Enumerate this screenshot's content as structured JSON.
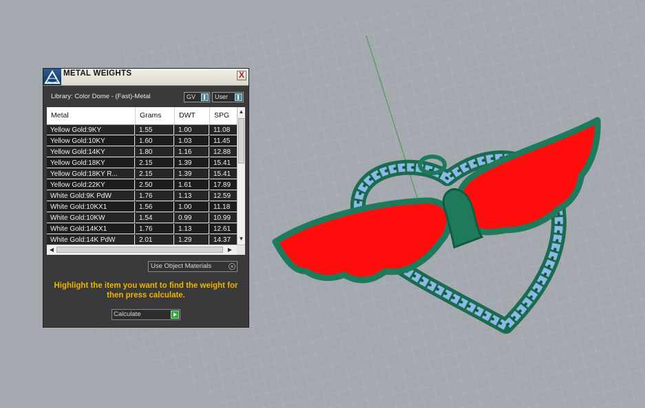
{
  "panel": {
    "title": "METAL WEIGHTS",
    "close_label": "X",
    "library_label": "Library: Color Dome - (Fast)-Metal",
    "unit_select": "GV",
    "mode_select": "User",
    "columns": [
      "Metal",
      "Grams",
      "DWT",
      "SPG"
    ],
    "rows": [
      {
        "metal": "Yellow Gold:9KY",
        "grams": "1.55",
        "dwt": "1.00",
        "spg": "11.08"
      },
      {
        "metal": "Yellow Gold:10KY",
        "grams": "1.60",
        "dwt": "1.03",
        "spg": "11.45"
      },
      {
        "metal": "Yellow Gold:14KY",
        "grams": "1.80",
        "dwt": "1.16",
        "spg": "12.88"
      },
      {
        "metal": "Yellow Gold:18KY",
        "grams": "2.15",
        "dwt": "1.39",
        "spg": "15.41"
      },
      {
        "metal": "Yellow Gold:18KY R...",
        "grams": "2.15",
        "dwt": "1.39",
        "spg": "15.41"
      },
      {
        "metal": "Yellow Gold:22KY",
        "grams": "2.50",
        "dwt": "1.61",
        "spg": "17.89"
      },
      {
        "metal": "White Gold:9K PdW",
        "grams": "1.76",
        "dwt": "1.13",
        "spg": "12.59"
      },
      {
        "metal": "White Gold:10KX1",
        "grams": "1.56",
        "dwt": "1.00",
        "spg": "11.18"
      },
      {
        "metal": "White Gold:10KW",
        "grams": "1.54",
        "dwt": "0.99",
        "spg": "10.99"
      },
      {
        "metal": "White Gold:14KX1",
        "grams": "1.76",
        "dwt": "1.13",
        "spg": "12.61"
      },
      {
        "metal": "White Gold:14K PdW",
        "grams": "2.01",
        "dwt": "1.29",
        "spg": "14.37"
      }
    ],
    "use_object_materials_label": "Use Object Materials",
    "instructions": "Highlight the item you want to find the weight for then press calculate.",
    "calculate_label": "Calculate"
  },
  "colors": {
    "viewport_bg": "#a3a9ae",
    "grid_line": "#b6bbbf",
    "axis_green": "#4aa04a",
    "metal_green": "#1f7a5c",
    "enamel_red": "#ff0d0d",
    "stone_blue": "#8cb8e6",
    "instructions": "#f0b400"
  },
  "icons": {
    "panel_logo": "dome-logo-icon",
    "close": "close-icon",
    "scroll_up": "scroll-up-icon",
    "scroll_down": "scroll-down-icon",
    "scroll_left": "scroll-left-icon",
    "scroll_right": "scroll-right-icon",
    "calculate": "play-arrow-icon"
  }
}
